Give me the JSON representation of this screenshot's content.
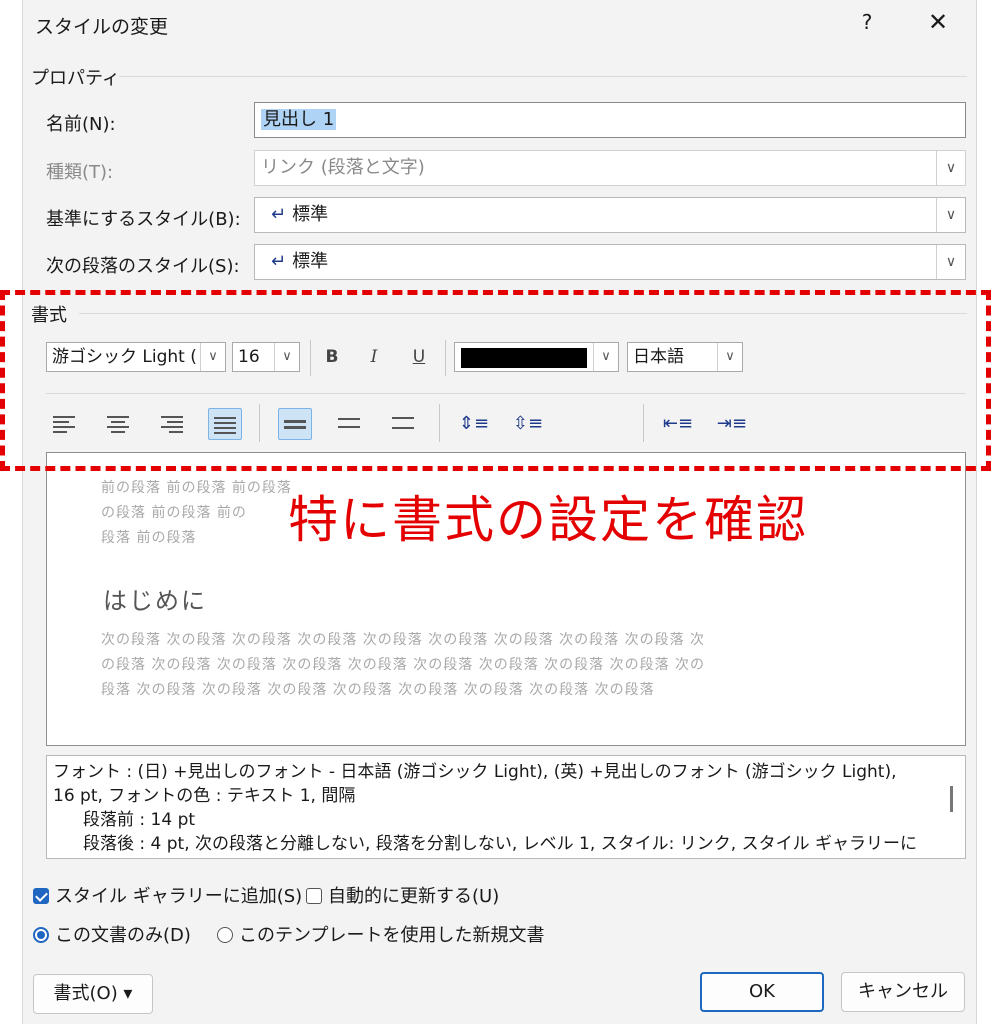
{
  "dialog": {
    "title": "スタイルの変更",
    "help": "?",
    "close": "✕"
  },
  "properties": {
    "label": "プロパティ",
    "name_label": "名前(N):",
    "name_value": "見出し 1",
    "type_label": "種類(T):",
    "type_value": "リンク (段落と文字)",
    "base_label": "基準にするスタイル(B):",
    "base_value": "標準",
    "next_label": "次の段落のスタイル(S):",
    "next_value": "標準",
    "para_glyph": "↵",
    "dropdown_glyph": "∨"
  },
  "format": {
    "label": "書式",
    "font": "游ゴシック Light (",
    "size": "16",
    "bold": "B",
    "italic": "I",
    "underline": "U",
    "color_hex": "#000000",
    "language": "日本語"
  },
  "preview": {
    "prev_lines": [
      "前の段落 前の段落 前の段落",
      "の段落 前の段落 前の",
      "段落 前の段落"
    ],
    "heading": "はじめに",
    "next_lines": [
      "次の段落 次の段落 次の段落 次の段落 次の段落 次の段落 次の段落 次の段落 次の段落 次",
      "の段落 次の段落 次の段落 次の段落 次の段落 次の段落 次の段落 次の段落 次の段落 次の",
      "段落 次の段落 次の段落 次の段落 次の段落 次の段落 次の段落 次の段落 次の段落"
    ]
  },
  "description": {
    "line1": "フォント : (日) +見出しのフォント - 日本語 (游ゴシック Light), (英) +見出しのフォント (游ゴシック Light),",
    "line2": "16 pt, フォントの色 : テキスト 1, 間隔",
    "line3": "段落前 :  14 pt",
    "line4": "段落後 :  4 pt, 次の段落と分離しない, 段落を分割しない, レベル 1, スタイル: リンク, スタイル ギャラリーに"
  },
  "options": {
    "add_gallery": "スタイル ギャラリーに追加(S)",
    "auto_update": "自動的に更新する(U)",
    "this_doc": "この文書のみ(D)",
    "new_docs": "このテンプレートを使用した新規文書"
  },
  "buttons": {
    "format": "書式(O) ▾",
    "ok": "OK",
    "cancel": "キャンセル"
  },
  "annotation": {
    "text": "特に書式の設定を確認",
    "color": "#e40000"
  }
}
